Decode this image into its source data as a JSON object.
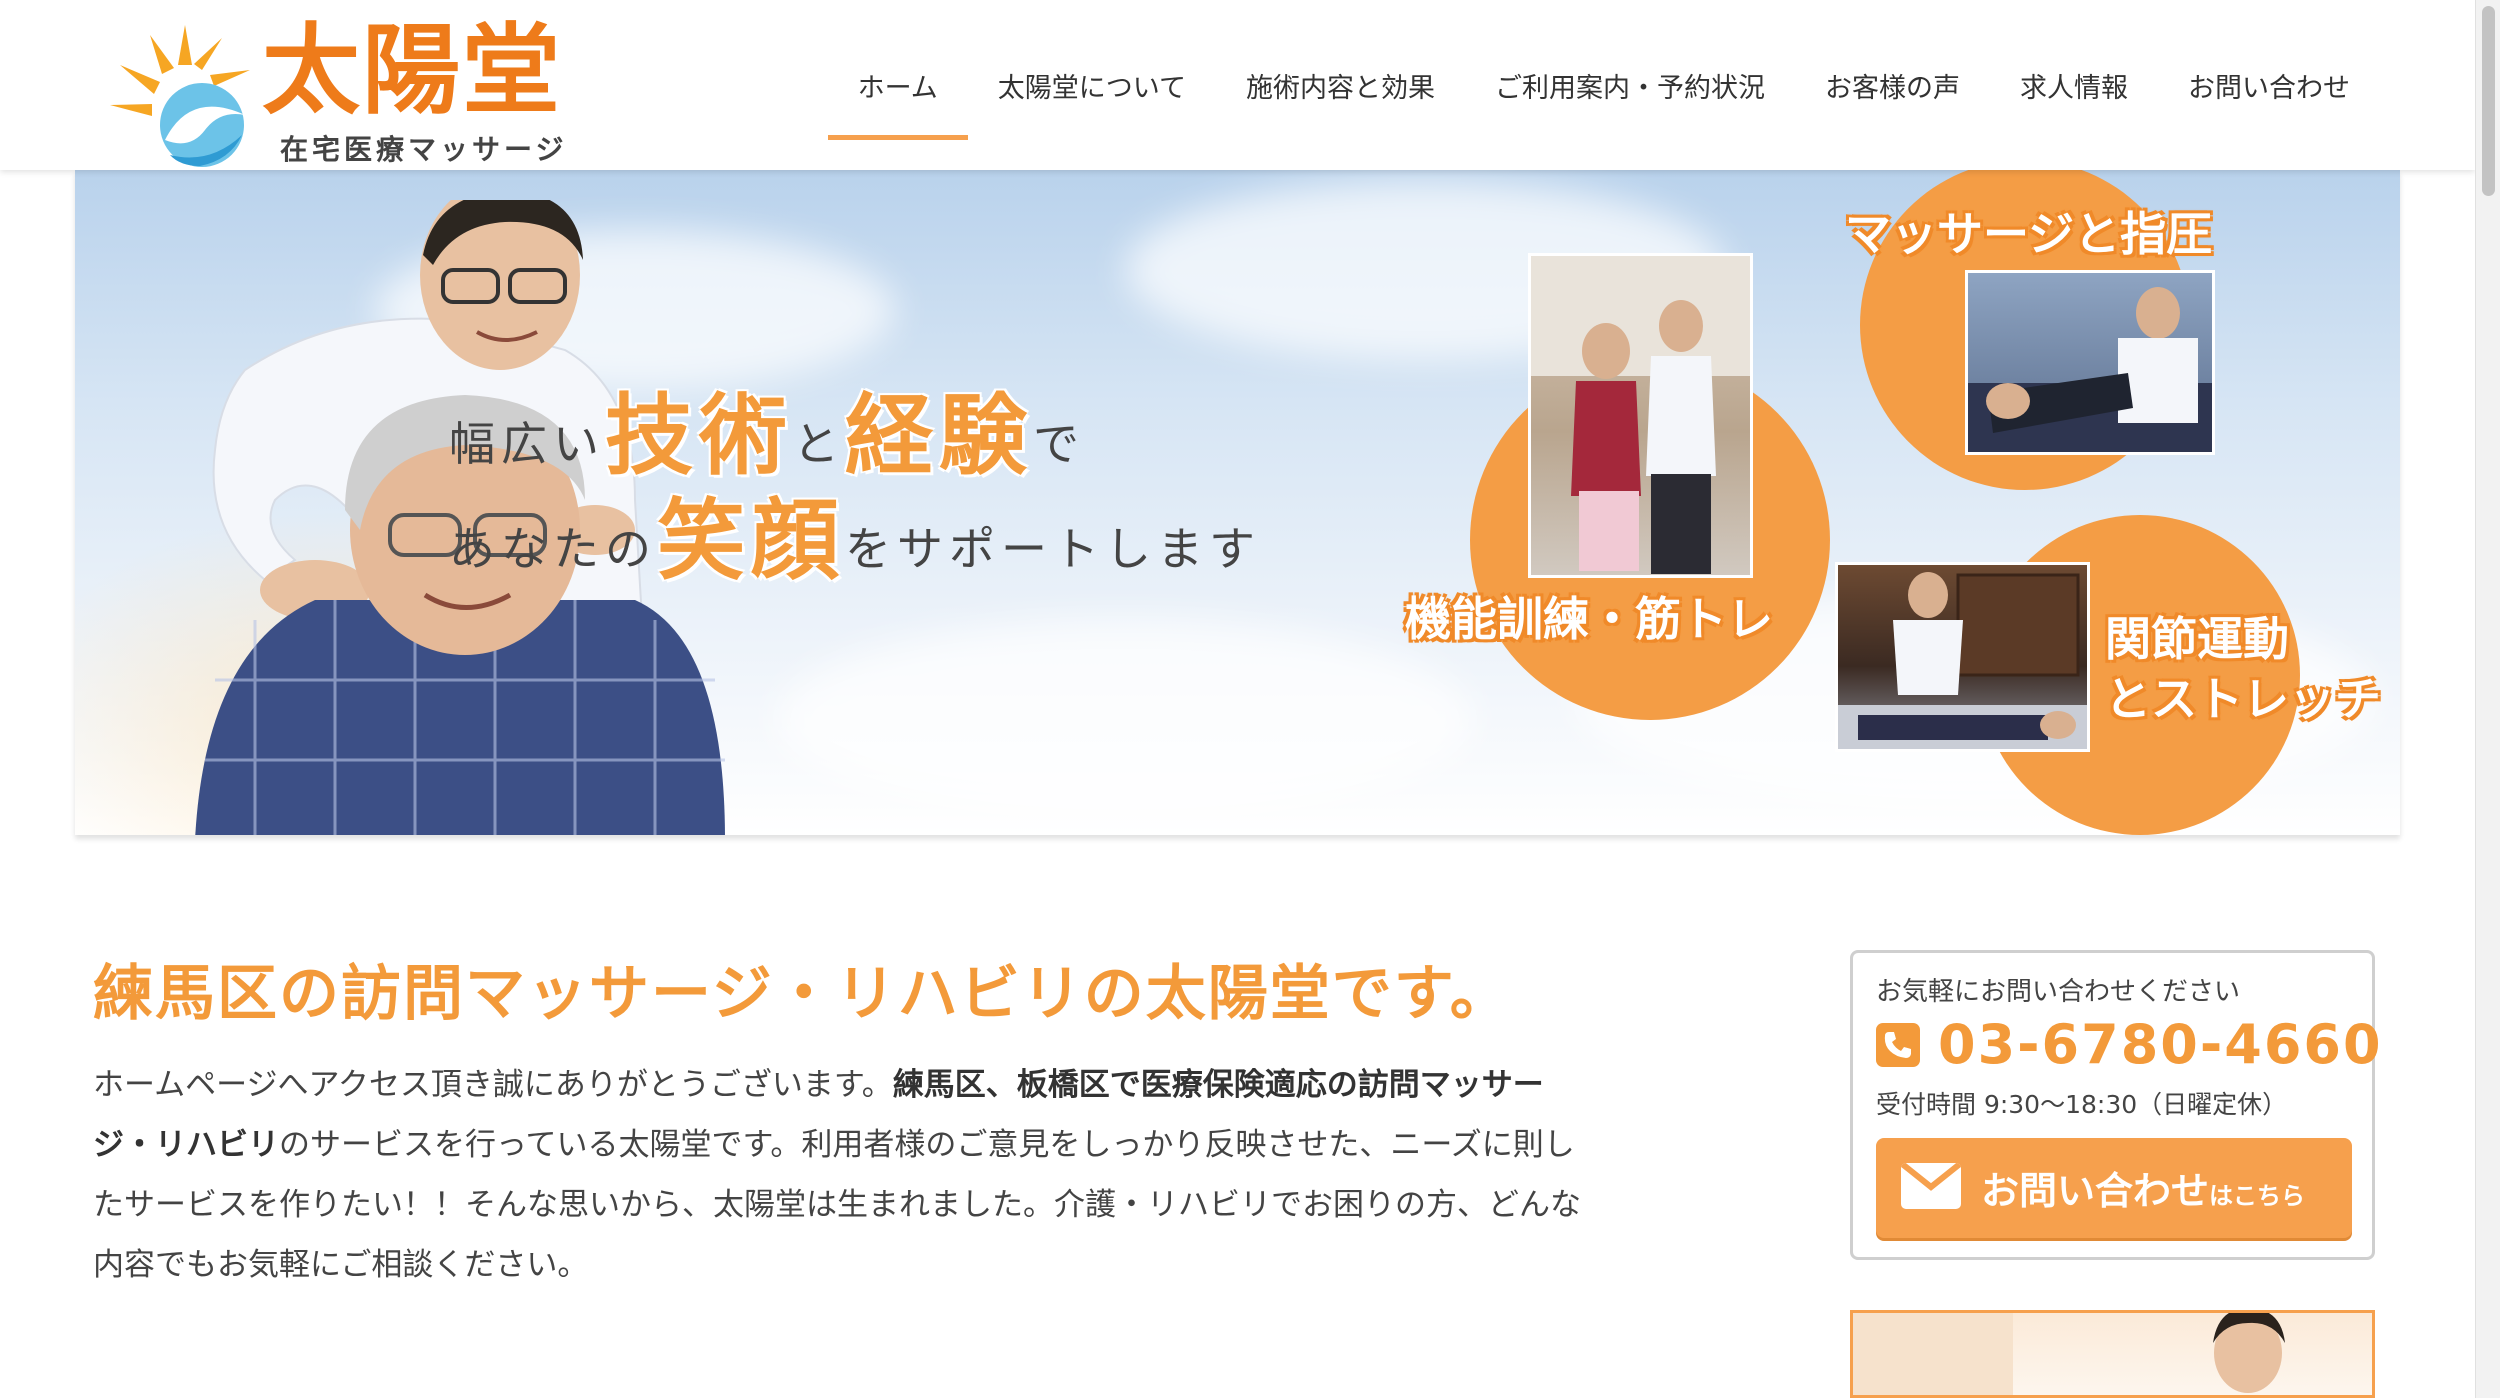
{
  "brand": {
    "name": "太陽堂",
    "tagline": "在宅医療マッサージ"
  },
  "nav": {
    "items": [
      {
        "label": "ホーム",
        "active": true
      },
      {
        "label": "太陽堂について"
      },
      {
        "label": "施術内容と効果"
      },
      {
        "label": "ご利用案内・予約状況"
      },
      {
        "label": "お客様の声"
      },
      {
        "label": "求人情報"
      },
      {
        "label": "お問い合わせ"
      }
    ]
  },
  "hero": {
    "line1_pre": "幅広い",
    "line1_big1": "技術",
    "line1_mid": "と",
    "line1_big2": "経験",
    "line1_post": "で",
    "line2_pre": "あなたの",
    "line2_big": "笑顔",
    "line2_post": "をサポートします",
    "services": [
      "機能訓練・筋トレ",
      "マッサージと指圧",
      "関節運動",
      "とストレッチ"
    ]
  },
  "main": {
    "title": "練馬区の訪問マッサージ・リハビリの太陽堂です。",
    "intro_1": "ホームページへアクセス頂き誠にありがとうございます。",
    "intro_bold": "練馬区、板橋区で医療保険適応の訪問マッサージ・リハビリ",
    "intro_2": "のサービスを行っている太陽堂です。利用者様のご意見をしっかり反映させた、ニーズに則したサービスを作りたい！！そんな思いから、太陽堂は生まれました。介護・リハビリでお困りの方、どんな内容でもお気軽にご相談ください。"
  },
  "contact": {
    "lead": "お気軽にお問い合わせください",
    "phone": "03-6780-4660",
    "hours": "受付時間 9:30〜18:30（日曜定休）",
    "button_main": "お問い合わせ",
    "button_small": "はこちら"
  },
  "colors": {
    "accent": "#f39a3a",
    "button": "#f6a04d",
    "logo": "#ee7b1a"
  }
}
